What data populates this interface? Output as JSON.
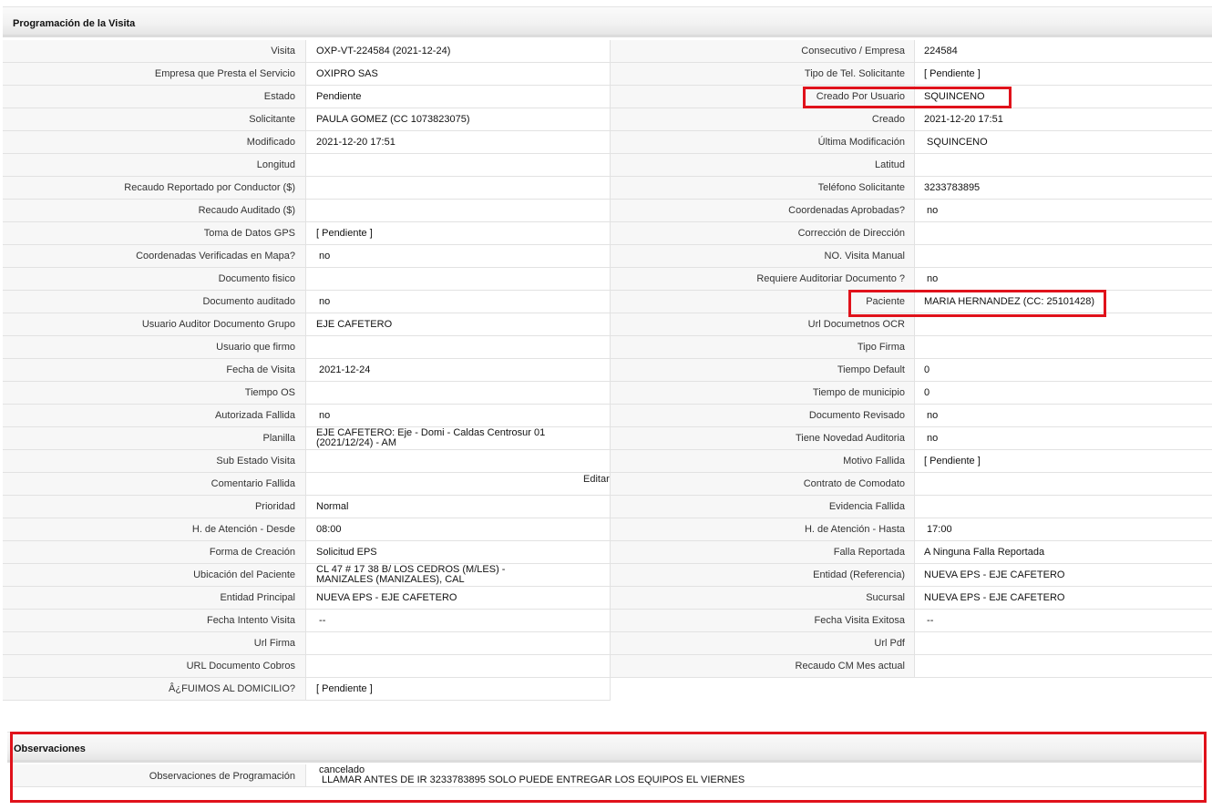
{
  "section1_title": "Programación de la Visita",
  "rows": [
    {
      "l1": "Visita",
      "v1": "OXP-VT-224584 (2021-12-24)",
      "l2": "Consecutivo / Empresa",
      "v2": "224584"
    },
    {
      "l1": "Empresa que Presta el Servicio",
      "v1": "OXIPRO SAS",
      "l2": "Tipo de Tel. Solicitante",
      "v2": "[ Pendiente ]"
    },
    {
      "l1": "Estado",
      "v1": "Pendiente",
      "l2": "Creado Por Usuario",
      "v2": "SQUINCENO"
    },
    {
      "l1": "Solicitante",
      "v1": "PAULA GOMEZ (CC 1073823075)",
      "l2": "Creado",
      "v2": "2021-12-20 17:51"
    },
    {
      "l1": "Modificado",
      "v1": "2021-12-20 17:51",
      "l2": "Última Modificación",
      "v2": " SQUINCENO"
    },
    {
      "l1": "Longitud",
      "v1": "",
      "l2": "Latitud",
      "v2": ""
    },
    {
      "l1": "Recaudo Reportado por Conductor ($)",
      "v1": "",
      "l2": "Teléfono Solicitante",
      "v2": "3233783895"
    },
    {
      "l1": "Recaudo Auditado ($)",
      "v1": "",
      "l2": "Coordenadas Aprobadas?",
      "v2": " no"
    },
    {
      "l1": "Toma de Datos GPS",
      "v1": "[ Pendiente ]",
      "l2": "Corrección de Dirección",
      "v2": ""
    },
    {
      "l1": "Coordenadas Verificadas en Mapa?",
      "v1": " no",
      "l2": "NO. Visita Manual",
      "v2": ""
    },
    {
      "l1": "Documento fisico",
      "v1": "",
      "l2": "Requiere Auditoriar Documento ?",
      "v2": " no"
    },
    {
      "l1": "Documento auditado",
      "v1": " no",
      "l2": "Paciente",
      "v2": "MARIA HERNANDEZ (CC: 25101428)"
    },
    {
      "l1": "Usuario Auditor Documento Grupo",
      "v1": "EJE CAFETERO",
      "l2": "Url Documetnos OCR",
      "v2": ""
    },
    {
      "l1": "Usuario que firmo",
      "v1": "",
      "l2": "Tipo Firma",
      "v2": ""
    },
    {
      "l1": "Fecha de Visita",
      "v1": " 2021-12-24",
      "l2": "Tiempo Default",
      "v2": "0"
    },
    {
      "l1": "Tiempo OS",
      "v1": "",
      "l2": "Tiempo de municipio",
      "v2": "0"
    },
    {
      "l1": "Autorizada Fallida",
      "v1": " no",
      "l2": "Documento Revisado",
      "v2": " no"
    },
    {
      "l1": "Planilla",
      "v1": "EJE CAFETERO: Eje - Domi - Caldas Centrosur 01 (2021/12/24) - AM",
      "l2": "Tiene Novedad Auditoria",
      "v2": " no"
    },
    {
      "l1": "Sub Estado Visita",
      "v1": "",
      "l2": "Motivo Fallida",
      "v2": "[ Pendiente ]"
    },
    {
      "l1": "Comentario Fallida",
      "v1": "",
      "l2": "Contrato de Comodato",
      "v2": ""
    },
    {
      "l1": "Prioridad",
      "v1": "Normal",
      "l2": "Evidencia Fallida",
      "v2": ""
    },
    {
      "l1": "H. de Atención - Desde",
      "v1": "08:00",
      "l2": "H. de Atención - Hasta",
      "v2": " 17:00"
    },
    {
      "l1": "Forma de Creación",
      "v1": "Solicitud EPS",
      "l2": "Falla Reportada",
      "v2": "A Ninguna Falla Reportada"
    },
    {
      "l1": "Ubicación del Paciente",
      "v1": "CL 47 # 17 38 B/ LOS CEDROS (M/LES) - MANIZALES (MANIZALES), CAL",
      "l2": "Entidad (Referencia)",
      "v2": "NUEVA EPS - EJE CAFETERO"
    },
    {
      "l1": "Entidad Principal",
      "v1": "NUEVA EPS - EJE CAFETERO",
      "l2": "Sucursal",
      "v2": "NUEVA EPS - EJE CAFETERO"
    },
    {
      "l1": "Fecha Intento Visita",
      "v1": " --",
      "l2": "Fecha Visita Exitosa",
      "v2": " --"
    },
    {
      "l1": "Url Firma",
      "v1": "",
      "l2": "Url Pdf",
      "v2": ""
    },
    {
      "l1": "URL Documento Cobros",
      "v1": "",
      "l2": "Recaudo CM Mes actual",
      "v2": ""
    },
    {
      "l1": "Â¿FUIMOS AL DOMICILIO?",
      "v1": "[ Pendiente ]"
    }
  ],
  "edit_label": "Editar",
  "section2_title": "Observaciones",
  "observaciones": {
    "label": "Observaciones de Programación",
    "line1": "cancelado",
    "line2": " LLAMAR ANTES DE IR 3233783895 SOLO PUEDE ENTREGAR LOS EQUIPOS EL VIERNES"
  },
  "highlight_color": "#e0121b"
}
